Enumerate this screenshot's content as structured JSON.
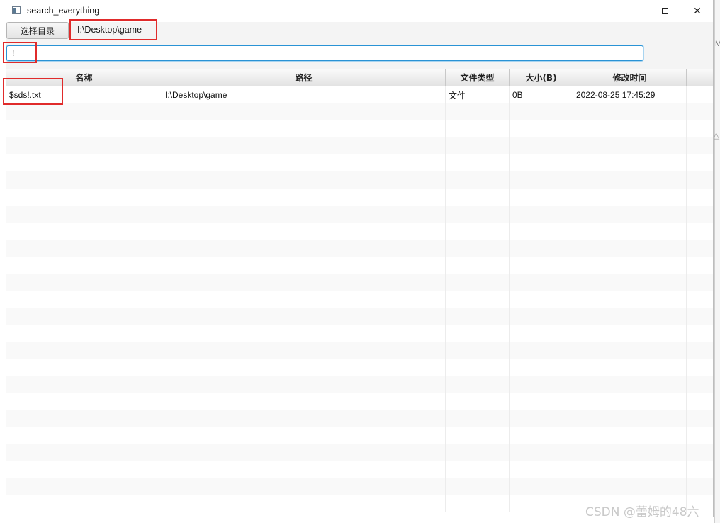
{
  "window": {
    "title": "search_everything"
  },
  "toolbar": {
    "choose_dir_label": "选择目录",
    "current_path": "I:\\Desktop\\game"
  },
  "search": {
    "value": "!"
  },
  "table": {
    "columns": [
      "名称",
      "路径",
      "文件类型",
      "大小(B)",
      "修改时间",
      ""
    ],
    "rows": [
      [
        "$sds!.txt",
        "I:\\Desktop\\game",
        "文件",
        "0B",
        "2022-08-25 17:45:29",
        ""
      ]
    ]
  },
  "background": {
    "right_edge_letter": "M",
    "right_edge_glyph": "△"
  },
  "watermark": "CSDN @蕾姆的48六",
  "colors": {
    "accent_focus": "#2a93d5",
    "annotation_red": "#e02b2b"
  }
}
